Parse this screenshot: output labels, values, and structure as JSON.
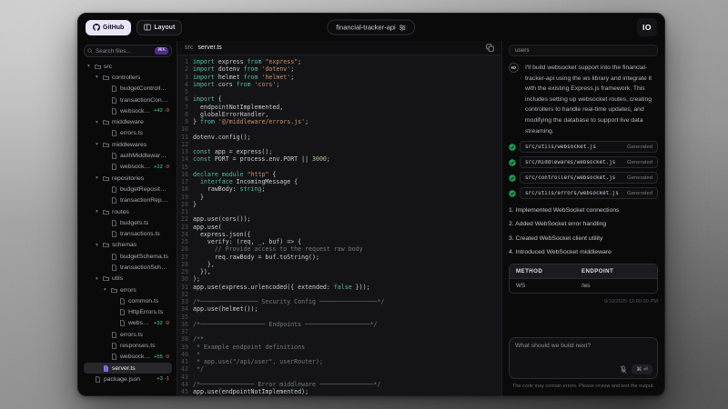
{
  "topbar": {
    "github_button": "GitHub",
    "layout_button": "Layout",
    "project_name": "financial-tracker-api",
    "logo_text": "IO"
  },
  "sidebar": {
    "search_placeholder": "Search files...",
    "search_shortcut": "⌘K",
    "tree": [
      {
        "label": "src",
        "type": "folder",
        "depth": 0
      },
      {
        "label": "controllers",
        "type": "folder",
        "depth": 1
      },
      {
        "label": "budgetController.ts",
        "type": "file",
        "depth": 2
      },
      {
        "label": "transactionController.ts",
        "type": "file",
        "depth": 2
      },
      {
        "label": "websocket.js",
        "type": "file",
        "depth": 2,
        "add": "+42",
        "del": "-0"
      },
      {
        "label": "middleware",
        "type": "folder",
        "depth": 1
      },
      {
        "label": "errors.ts",
        "type": "file",
        "depth": 2
      },
      {
        "label": "middlewares",
        "type": "folder",
        "depth": 1
      },
      {
        "label": "authMiddleware.ts",
        "type": "file",
        "depth": 2
      },
      {
        "label": "websocket.js",
        "type": "file",
        "depth": 2,
        "add": "+22",
        "del": "-0"
      },
      {
        "label": "repositories",
        "type": "folder",
        "depth": 1
      },
      {
        "label": "budgetRepository.ts",
        "type": "file",
        "depth": 2
      },
      {
        "label": "transactionRepository.ts",
        "type": "file",
        "depth": 2
      },
      {
        "label": "routes",
        "type": "folder",
        "depth": 1
      },
      {
        "label": "budgets.ts",
        "type": "file",
        "depth": 2
      },
      {
        "label": "transactions.ts",
        "type": "file",
        "depth": 2
      },
      {
        "label": "schemas",
        "type": "folder",
        "depth": 1
      },
      {
        "label": "budgetSchema.ts",
        "type": "file",
        "depth": 2
      },
      {
        "label": "transactionSchema.ts",
        "type": "file",
        "depth": 2
      },
      {
        "label": "utils",
        "type": "folder",
        "depth": 1
      },
      {
        "label": "errors",
        "type": "folder",
        "depth": 2
      },
      {
        "label": "common.ts",
        "type": "file",
        "depth": 3
      },
      {
        "label": "HttpErrors.ts",
        "type": "file",
        "depth": 3
      },
      {
        "label": "websocket.js",
        "type": "file",
        "depth": 3,
        "add": "+32",
        "del": "-0"
      },
      {
        "label": "errors.ts",
        "type": "file",
        "depth": 2
      },
      {
        "label": "responses.ts",
        "type": "file",
        "depth": 2
      },
      {
        "label": "websocket.js",
        "type": "file",
        "depth": 2,
        "add": "+55",
        "del": "-0"
      },
      {
        "label": "server.ts",
        "type": "file",
        "depth": 1,
        "selected": true
      },
      {
        "label": "package.json",
        "type": "file",
        "depth": 0,
        "add": "+3",
        "del": "-1"
      }
    ]
  },
  "editor": {
    "breadcrumb_dir": "src",
    "breadcrumb_file": "server.ts",
    "lines": [
      "import express from \"express\";",
      "import dotenv from 'dotenv';",
      "import helmet from 'helmet';",
      "import cors from 'cors';",
      "",
      "import {",
      "  endpointNotImplemented,",
      "  globalErrorHandler,",
      "} from '@/middleware/errors.js';",
      "",
      "dotenv.config();",
      "",
      "const app = express();",
      "const PORT = process.env.PORT || 3000;",
      "",
      "declare module \"http\" {",
      "  interface IncomingMessage {",
      "    rawBody: string;",
      "  }",
      "}",
      "",
      "app.use(cors());",
      "app.use(",
      "  express.json({",
      "    verify: (req, _, buf) => {",
      "      // Provide access to the request raw body",
      "      req.rawBody = buf.toString();",
      "    },",
      "  }),",
      ");",
      "app.use(express.urlencoded({ extended: false }));",
      "",
      "/*──────────────── Security Config ────────────────*/",
      "app.use(helmet());",
      "",
      "/*────────────────── Endpoints ──────────────────*/",
      "",
      "/**",
      " * Example endpoint definitions",
      " *",
      " * app.use(\"/api/user\", userRouter);",
      " */",
      "",
      "/*─────────────── Error middleware ───────────────*/",
      "app.use(endpointNotImplemented);"
    ]
  },
  "chat": {
    "tab_label": "users",
    "avatar_text": "IO",
    "message": "I'll build websocket support into the financial-tracker-api using the ws library and integrate it with the existing Express.js framework. This includes setting up websocket routes, creating controllers to handle real-time updates, and modifying the database to support live data streaming.",
    "generated_files": [
      {
        "path": "src/utils/websocket.js",
        "status": "Generated"
      },
      {
        "path": "src/middlewares/websocket.js",
        "status": "Generated"
      },
      {
        "path": "src/controllers/websocket.js",
        "status": "Generated"
      },
      {
        "path": "src/utils/errors/websocket.js",
        "status": "Generated"
      }
    ],
    "steps": [
      "1. Implemented WebSocket connections",
      "2. Added WebSocket error handling",
      "3. Created WebSocket client utility",
      "4. Introduced WebSocket middleware"
    ],
    "table": {
      "headers": [
        "METHOD",
        "ENDPOINT"
      ],
      "rows": [
        [
          "WS",
          "/ws"
        ]
      ]
    },
    "timestamp": "9/10/2025 12:00:00 PM",
    "input_placeholder": "What should we build next?",
    "send_shortcut": "⌘ ⏎",
    "disclaimer": "The code may contain errors. Please review and test the output."
  },
  "colors": {
    "accent_purple": "#7c5cf6",
    "diff_add": "#4ade80",
    "diff_del": "#f87171",
    "generated_check": "#1f9d55"
  }
}
